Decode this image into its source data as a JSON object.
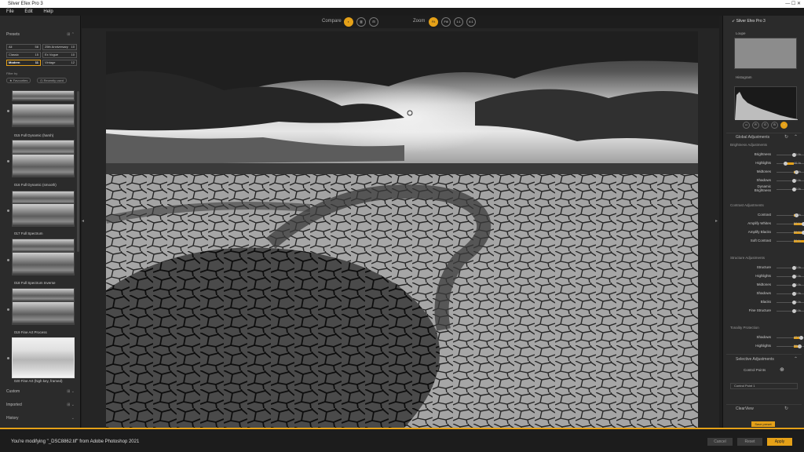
{
  "window": {
    "title": "Silver Efex Pro 3",
    "controls": "—  ☐  ✕"
  },
  "menu": [
    "File",
    "Edit",
    "Help"
  ],
  "left": {
    "presets_title": "Presets",
    "preset_categories": [
      {
        "label": "All",
        "count": "58"
      },
      {
        "label": "25th Anniversary",
        "count": "10"
      },
      {
        "label": "Classic",
        "count": "15"
      },
      {
        "label": "Ex Vogue",
        "count": "10"
      },
      {
        "label": "Modern",
        "count": "11"
      },
      {
        "label": "Vintage",
        "count": "12"
      }
    ],
    "filter_by": "Filter by",
    "filter_buttons": [
      "★ Favourites",
      "◷ Recently used"
    ],
    "presets": [
      {
        "label": "015 Full Dynamic (harsh)"
      },
      {
        "label": "016 Full Dynamic (smooth)"
      },
      {
        "label": "017 Full Spectrum"
      },
      {
        "label": "018 Full Spectrum Inverse"
      },
      {
        "label": "019 Fine Art Process"
      },
      {
        "label": "020 Fine Art (high key, framed)"
      }
    ],
    "bottom_sections": [
      {
        "label": "Custom"
      },
      {
        "label": "Imported"
      },
      {
        "label": "History"
      }
    ]
  },
  "toolbar": {
    "compare_label": "Compare",
    "zoom_label": "Zoom",
    "zoom_buttons": [
      "Fit",
      "Fill",
      "1:1",
      "4:1"
    ]
  },
  "right": {
    "brand": "Silver Efex Pro 3",
    "loupe": "Loupe",
    "histogram": "Histogram",
    "global_adjustments": "Global Adjustments",
    "brightness_title": "Brightness Adjustments",
    "brightness": [
      {
        "label": "Brightness",
        "value": "0 %",
        "level": 0
      },
      {
        "label": "Highlights",
        "value": "-46 %",
        "level": -0.46
      },
      {
        "label": "Midtones",
        "value": "18 %",
        "level": 0.18
      },
      {
        "label": "Shadows",
        "value": "0 %",
        "level": 0
      },
      {
        "label": "Dynamic Brightness",
        "value": "0 %",
        "level": 0
      }
    ],
    "contrast_title": "Contrast Adjustments",
    "contrast": [
      {
        "label": "Contrast",
        "value": "14 %",
        "level": 0.14
      },
      {
        "label": "Amplify Whites",
        "value": "58 %",
        "level": 0.58
      },
      {
        "label": "Amplify Blacks",
        "value": "56 %",
        "level": 0.56
      },
      {
        "label": "Soft Contrast",
        "value": "78 %",
        "level": 0.78
      }
    ],
    "structure_title": "Structure Adjustments",
    "structure": [
      {
        "label": "Structure",
        "value": "0 %",
        "level": 0
      },
      {
        "label": "Highlights",
        "value": "0 %",
        "level": 0
      },
      {
        "label": "Midtones",
        "value": "0 %",
        "level": 0
      },
      {
        "label": "Shadows",
        "value": "0 %",
        "level": 0
      },
      {
        "label": "Blacks",
        "value": "0 %",
        "level": 0
      },
      {
        "label": "Fine Structure",
        "value": "0 %",
        "level": 0
      }
    ],
    "tonality_title": "Tonality Protection",
    "tonality": [
      {
        "label": "Shadows",
        "value": "42 %",
        "level": 0.42
      },
      {
        "label": "Highlights",
        "value": "35 %",
        "level": 0.35
      }
    ],
    "selective": "Selective Adjustments",
    "control_points": "Control Points",
    "control_point_item": "Control Point 1",
    "clearview": "ClearView",
    "save_preset": "Save preset"
  },
  "bottom": {
    "message": "You're modifying \"_DSC8862.tif\" from Adobe Photoshop 2021",
    "cancel": "Cancel",
    "reset": "Reset",
    "apply": "Apply"
  },
  "colors": {
    "accent": "#e5a118",
    "panel": "#2b2b2b",
    "background": "#1e1e1e"
  }
}
